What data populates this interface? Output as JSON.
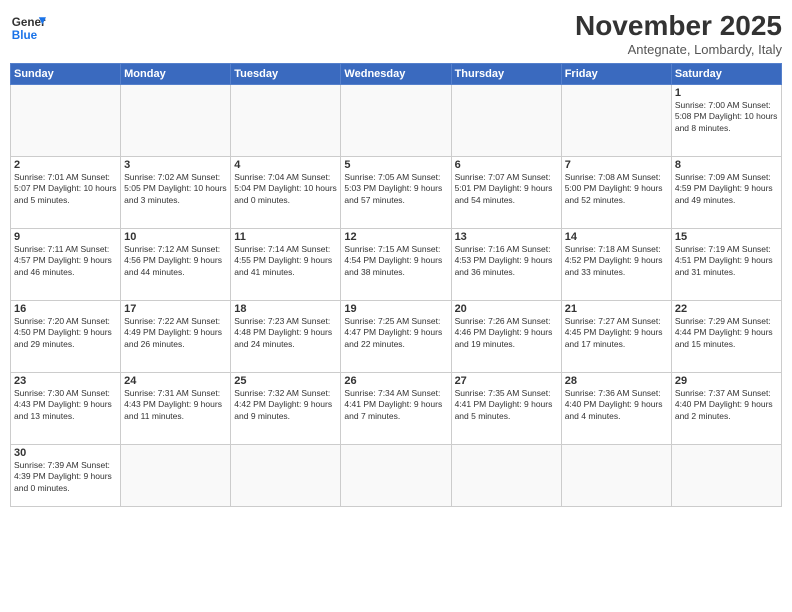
{
  "logo": {
    "text_general": "General",
    "text_blue": "Blue"
  },
  "header": {
    "month": "November 2025",
    "location": "Antegnate, Lombardy, Italy"
  },
  "days_of_week": [
    "Sunday",
    "Monday",
    "Tuesday",
    "Wednesday",
    "Thursday",
    "Friday",
    "Saturday"
  ],
  "weeks": [
    [
      {
        "day": "",
        "info": ""
      },
      {
        "day": "",
        "info": ""
      },
      {
        "day": "",
        "info": ""
      },
      {
        "day": "",
        "info": ""
      },
      {
        "day": "",
        "info": ""
      },
      {
        "day": "",
        "info": ""
      },
      {
        "day": "1",
        "info": "Sunrise: 7:00 AM\nSunset: 5:08 PM\nDaylight: 10 hours and 8 minutes."
      }
    ],
    [
      {
        "day": "2",
        "info": "Sunrise: 7:01 AM\nSunset: 5:07 PM\nDaylight: 10 hours and 5 minutes."
      },
      {
        "day": "3",
        "info": "Sunrise: 7:02 AM\nSunset: 5:05 PM\nDaylight: 10 hours and 3 minutes."
      },
      {
        "day": "4",
        "info": "Sunrise: 7:04 AM\nSunset: 5:04 PM\nDaylight: 10 hours and 0 minutes."
      },
      {
        "day": "5",
        "info": "Sunrise: 7:05 AM\nSunset: 5:03 PM\nDaylight: 9 hours and 57 minutes."
      },
      {
        "day": "6",
        "info": "Sunrise: 7:07 AM\nSunset: 5:01 PM\nDaylight: 9 hours and 54 minutes."
      },
      {
        "day": "7",
        "info": "Sunrise: 7:08 AM\nSunset: 5:00 PM\nDaylight: 9 hours and 52 minutes."
      },
      {
        "day": "8",
        "info": "Sunrise: 7:09 AM\nSunset: 4:59 PM\nDaylight: 9 hours and 49 minutes."
      }
    ],
    [
      {
        "day": "9",
        "info": "Sunrise: 7:11 AM\nSunset: 4:57 PM\nDaylight: 9 hours and 46 minutes."
      },
      {
        "day": "10",
        "info": "Sunrise: 7:12 AM\nSunset: 4:56 PM\nDaylight: 9 hours and 44 minutes."
      },
      {
        "day": "11",
        "info": "Sunrise: 7:14 AM\nSunset: 4:55 PM\nDaylight: 9 hours and 41 minutes."
      },
      {
        "day": "12",
        "info": "Sunrise: 7:15 AM\nSunset: 4:54 PM\nDaylight: 9 hours and 38 minutes."
      },
      {
        "day": "13",
        "info": "Sunrise: 7:16 AM\nSunset: 4:53 PM\nDaylight: 9 hours and 36 minutes."
      },
      {
        "day": "14",
        "info": "Sunrise: 7:18 AM\nSunset: 4:52 PM\nDaylight: 9 hours and 33 minutes."
      },
      {
        "day": "15",
        "info": "Sunrise: 7:19 AM\nSunset: 4:51 PM\nDaylight: 9 hours and 31 minutes."
      }
    ],
    [
      {
        "day": "16",
        "info": "Sunrise: 7:20 AM\nSunset: 4:50 PM\nDaylight: 9 hours and 29 minutes."
      },
      {
        "day": "17",
        "info": "Sunrise: 7:22 AM\nSunset: 4:49 PM\nDaylight: 9 hours and 26 minutes."
      },
      {
        "day": "18",
        "info": "Sunrise: 7:23 AM\nSunset: 4:48 PM\nDaylight: 9 hours and 24 minutes."
      },
      {
        "day": "19",
        "info": "Sunrise: 7:25 AM\nSunset: 4:47 PM\nDaylight: 9 hours and 22 minutes."
      },
      {
        "day": "20",
        "info": "Sunrise: 7:26 AM\nSunset: 4:46 PM\nDaylight: 9 hours and 19 minutes."
      },
      {
        "day": "21",
        "info": "Sunrise: 7:27 AM\nSunset: 4:45 PM\nDaylight: 9 hours and 17 minutes."
      },
      {
        "day": "22",
        "info": "Sunrise: 7:29 AM\nSunset: 4:44 PM\nDaylight: 9 hours and 15 minutes."
      }
    ],
    [
      {
        "day": "23",
        "info": "Sunrise: 7:30 AM\nSunset: 4:43 PM\nDaylight: 9 hours and 13 minutes."
      },
      {
        "day": "24",
        "info": "Sunrise: 7:31 AM\nSunset: 4:43 PM\nDaylight: 9 hours and 11 minutes."
      },
      {
        "day": "25",
        "info": "Sunrise: 7:32 AM\nSunset: 4:42 PM\nDaylight: 9 hours and 9 minutes."
      },
      {
        "day": "26",
        "info": "Sunrise: 7:34 AM\nSunset: 4:41 PM\nDaylight: 9 hours and 7 minutes."
      },
      {
        "day": "27",
        "info": "Sunrise: 7:35 AM\nSunset: 4:41 PM\nDaylight: 9 hours and 5 minutes."
      },
      {
        "day": "28",
        "info": "Sunrise: 7:36 AM\nSunset: 4:40 PM\nDaylight: 9 hours and 4 minutes."
      },
      {
        "day": "29",
        "info": "Sunrise: 7:37 AM\nSunset: 4:40 PM\nDaylight: 9 hours and 2 minutes."
      }
    ],
    [
      {
        "day": "30",
        "info": "Sunrise: 7:39 AM\nSunset: 4:39 PM\nDaylight: 9 hours and 0 minutes."
      },
      {
        "day": "",
        "info": ""
      },
      {
        "day": "",
        "info": ""
      },
      {
        "day": "",
        "info": ""
      },
      {
        "day": "",
        "info": ""
      },
      {
        "day": "",
        "info": ""
      },
      {
        "day": "",
        "info": ""
      }
    ]
  ]
}
